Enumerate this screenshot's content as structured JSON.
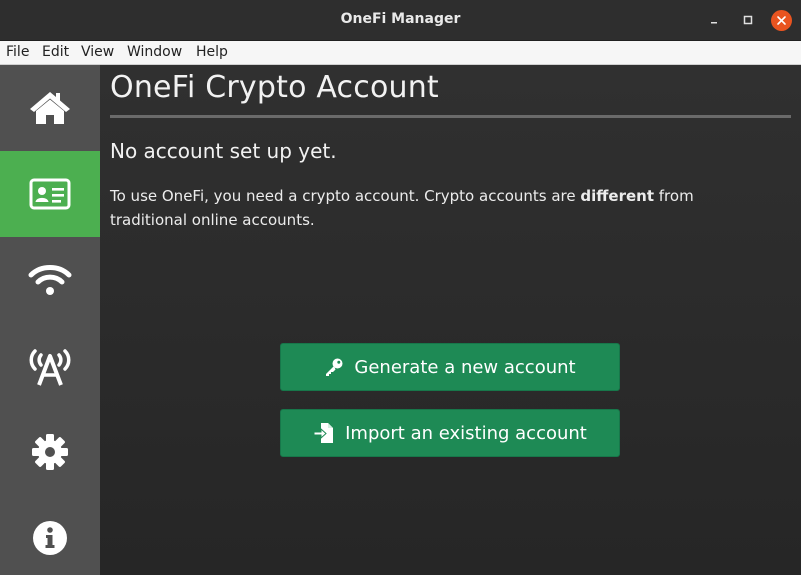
{
  "window": {
    "title": "OneFi Manager",
    "accent_close": "#e95420"
  },
  "menubar": {
    "items": [
      "File",
      "Edit",
      "View",
      "Window",
      "Help"
    ]
  },
  "sidebar": {
    "active_color": "#4caf50",
    "items": [
      {
        "icon": "home-icon"
      },
      {
        "icon": "id-card-icon",
        "active": true
      },
      {
        "icon": "wifi-icon"
      },
      {
        "icon": "antenna-icon"
      },
      {
        "icon": "gear-icon"
      },
      {
        "icon": "info-icon"
      }
    ]
  },
  "main": {
    "title": "OneFi Crypto Account",
    "status": "No account set up yet.",
    "description": {
      "before": "To use OneFi, you need a crypto account. Crypto accounts are ",
      "emphasis": "different",
      "after": " from traditional online accounts."
    },
    "buttons": {
      "generate_label": "Generate a new account",
      "import_label": "Import an existing account",
      "color": "#1e8a55"
    }
  }
}
